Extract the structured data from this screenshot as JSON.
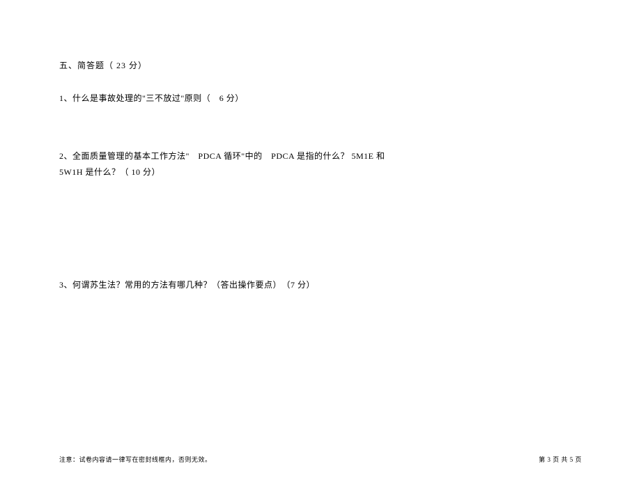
{
  "section": {
    "title": "五、简答题（ 23 分）"
  },
  "questions": {
    "q1": "1、什么是事故处理的\"三不放过\"原则（　6 分）",
    "q2_line1": "2、全面质量管理的基本工作方法\"　PDCA 循环\"中的　PDCA 是指的什么？ 5M1E 和",
    "q2_line2": "5W1H 是什么？（ 10 分）",
    "q3": "3、何谓苏生法？常用的方法有哪几种？（答出操作要点）　（7 分）"
  },
  "footer": {
    "note": "注意：试卷内容请一律写在密封线框内，否则无效。",
    "page": "第 3 页 共 5 页"
  }
}
